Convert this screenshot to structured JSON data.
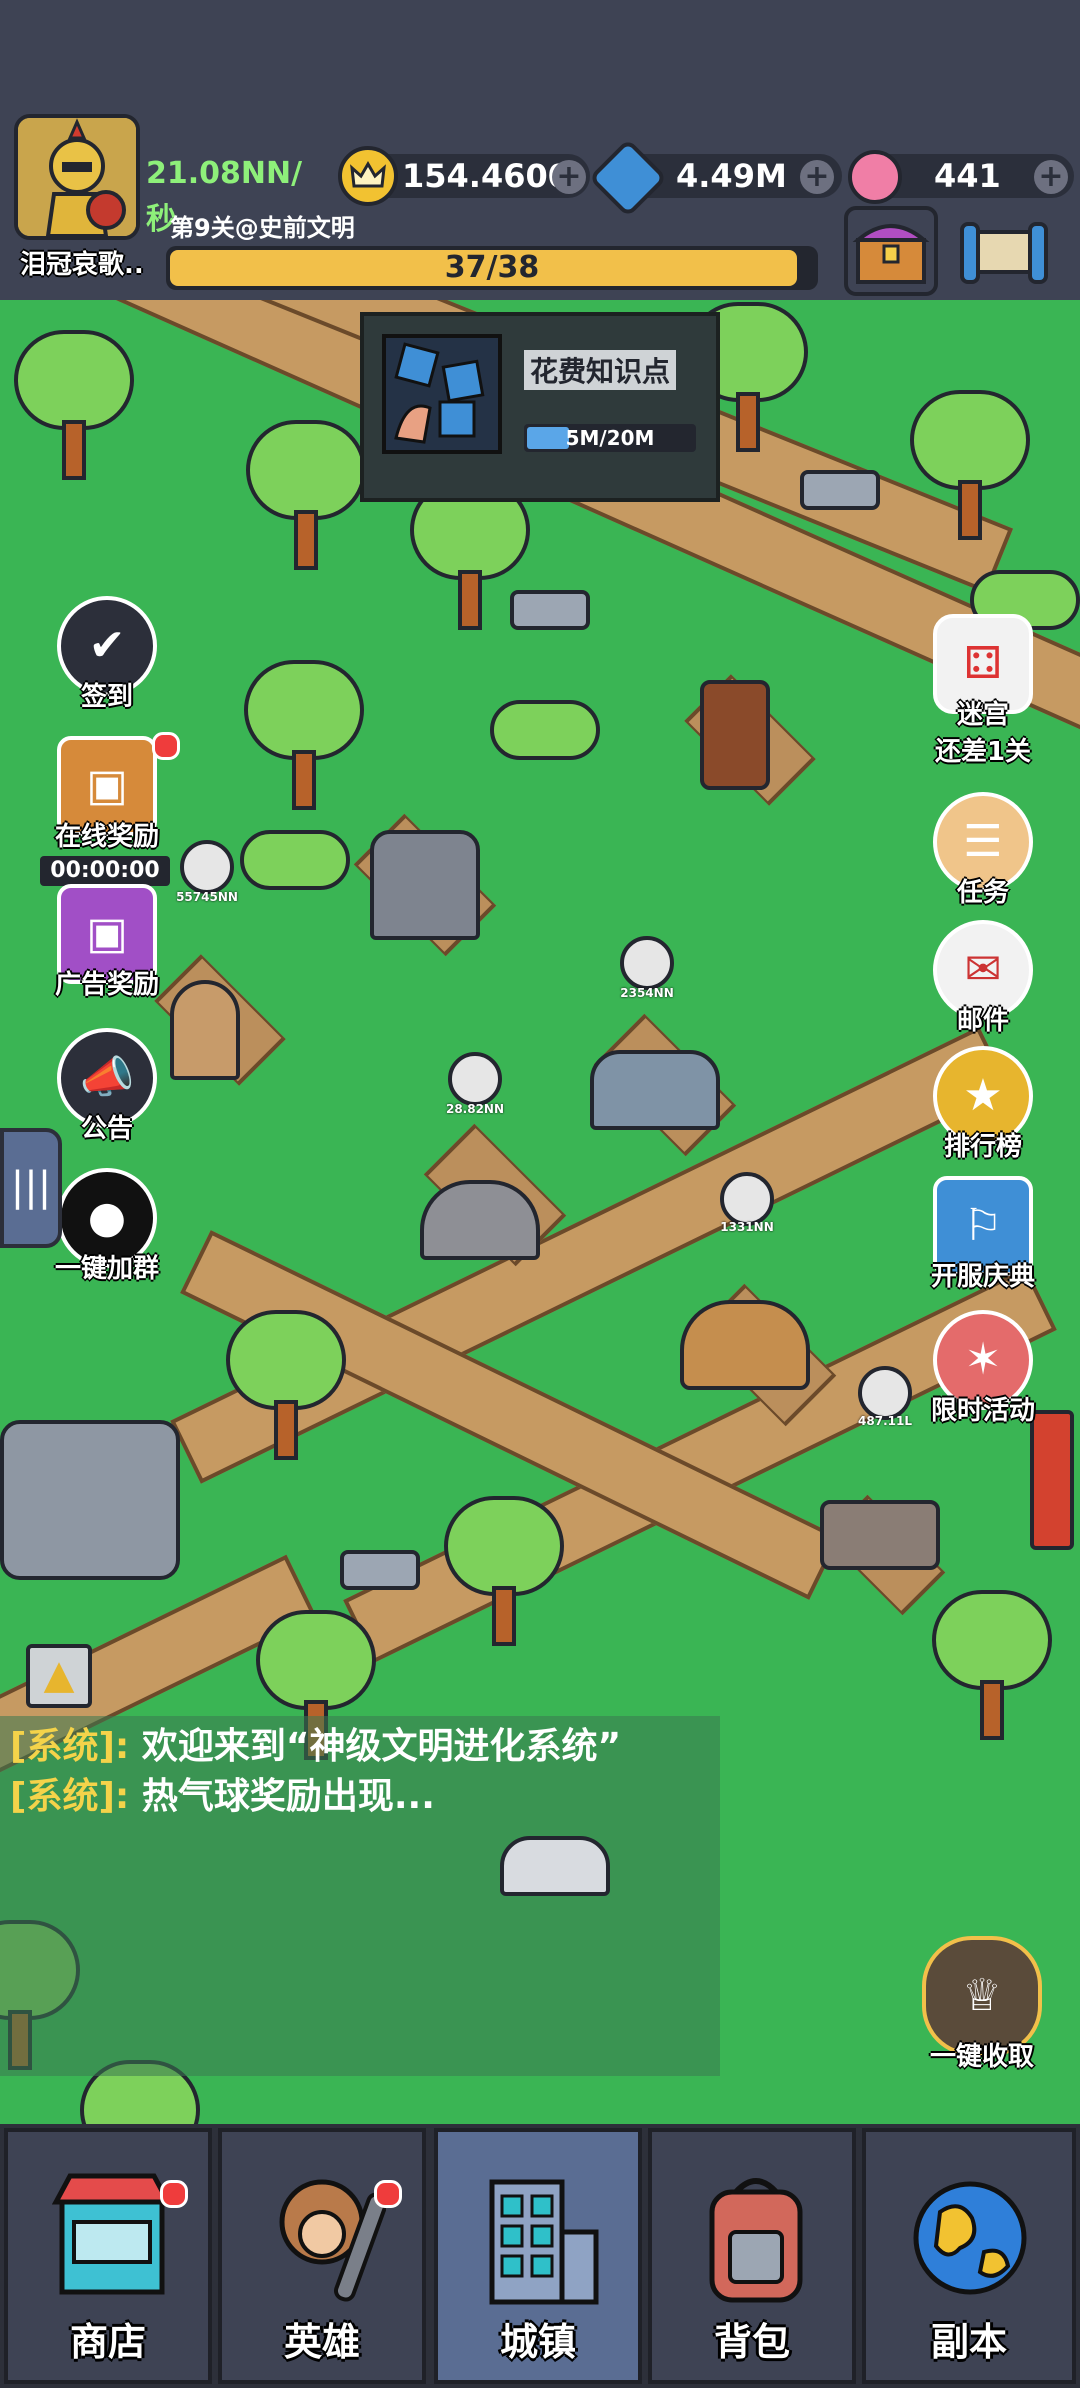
{
  "player": {
    "name": "泪冠哀歌..",
    "income_rate": "21.08NN/秒",
    "stage": "第9关@史前文明",
    "progress_text": "37/38",
    "progress_fraction": 0.974
  },
  "currencies": {
    "crown": "154.4600",
    "gem": "4.49M",
    "candy": "441"
  },
  "tooltip": {
    "title": "花费知识点",
    "progress_text": "5M/20M",
    "progress_fraction": 0.25
  },
  "left_buttons": {
    "checkin": "签到",
    "online_reward": "在线奖励",
    "online_timer": "00:00:00",
    "ad_reward": "广告奖励",
    "notice": "公告",
    "join_group": "一键加群"
  },
  "right_buttons": {
    "maze_line1": "迷宫",
    "maze_line2": "还差1关",
    "tasks": "任务",
    "mail": "邮件",
    "ranking": "排行榜",
    "server_celebration": "开服庆典",
    "limited_event": "限时活动",
    "collect_all": "一键收取"
  },
  "building_values": {
    "b1": "55745NN",
    "b2": "2354NN",
    "b3": "28.82NN",
    "b4": "1331NN",
    "b5": "487.11L"
  },
  "chat": {
    "tag": "[系统]:",
    "line1": "欢迎来到“神级文明进化系统”",
    "line2": "热气球奖励出现..."
  },
  "nav": {
    "shop": "商店",
    "heroes": "英雄",
    "town": "城镇",
    "backpack": "背包",
    "dungeon": "副本"
  },
  "colors": {
    "grass": "#3ab554",
    "road": "#c69a62",
    "topbar": "#3e4354",
    "progress": "#f2c04a",
    "chat_tag": "#f4d34a"
  }
}
